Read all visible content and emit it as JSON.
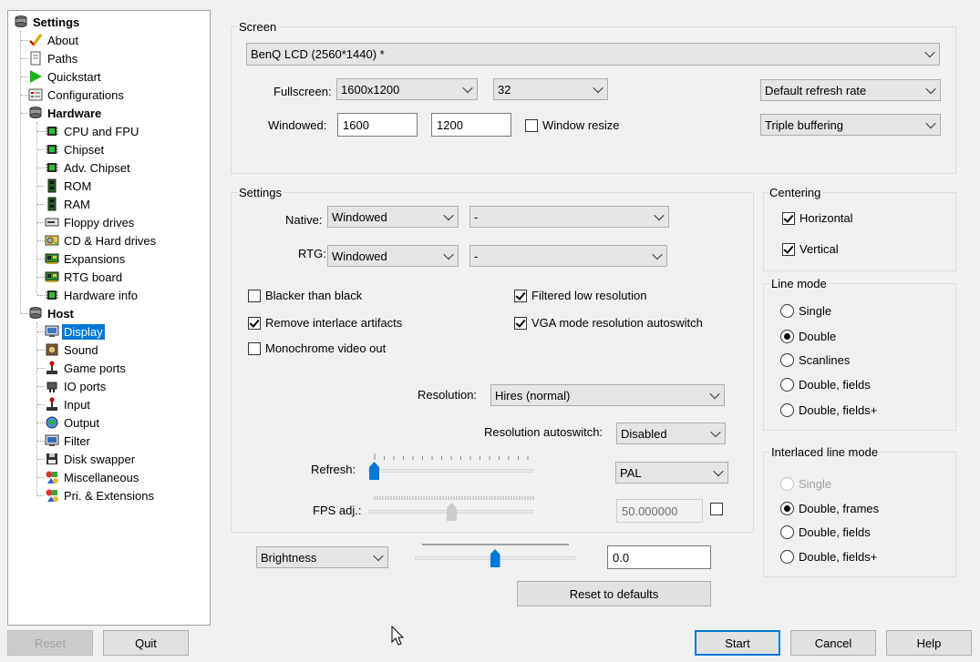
{
  "tree": {
    "items": [
      {
        "label": "Settings",
        "bold": true,
        "icon": "disk-stack-icon"
      },
      {
        "label": "About",
        "icon": "checkmark-pen-icon"
      },
      {
        "label": "Paths",
        "icon": "document-icon"
      },
      {
        "label": "Quickstart",
        "icon": "play-triangle-icon"
      },
      {
        "label": "Configurations",
        "icon": "list-window-icon"
      },
      {
        "label": "Hardware",
        "bold": true,
        "icon": "disk-stack-icon"
      },
      {
        "label": "CPU and FPU",
        "icon": "chip-icon"
      },
      {
        "label": "Chipset",
        "icon": "chip-icon"
      },
      {
        "label": "Adv. Chipset",
        "icon": "chip-icon"
      },
      {
        "label": "ROM",
        "icon": "memory-icon"
      },
      {
        "label": "RAM",
        "icon": "memory-icon"
      },
      {
        "label": "Floppy drives",
        "icon": "floppy-drive-icon"
      },
      {
        "label": "CD & Hard drives",
        "icon": "hard-drive-icon"
      },
      {
        "label": "Expansions",
        "icon": "expansion-card-icon"
      },
      {
        "label": "RTG board",
        "icon": "expansion-card-icon"
      },
      {
        "label": "Hardware info",
        "icon": "chip-icon"
      },
      {
        "label": "Host",
        "bold": true,
        "icon": "disk-stack-icon"
      },
      {
        "label": "Display",
        "selected": true,
        "icon": "monitor-icon"
      },
      {
        "label": "Sound",
        "icon": "speaker-icon"
      },
      {
        "label": "Game ports",
        "icon": "joystick-icon"
      },
      {
        "label": "IO ports",
        "icon": "plug-icon"
      },
      {
        "label": "Input",
        "icon": "joystick-icon"
      },
      {
        "label": "Output",
        "icon": "globe-icon"
      },
      {
        "label": "Filter",
        "icon": "monitor-filter-icon"
      },
      {
        "label": "Disk swapper",
        "icon": "disk-icon"
      },
      {
        "label": "Miscellaneous",
        "icon": "misc-shapes-icon"
      },
      {
        "label": "Pri. & Extensions",
        "icon": "misc-shapes-icon"
      }
    ]
  },
  "screen": {
    "title": "Screen",
    "monitor": "BenQ LCD (2560*1440) *",
    "fullscreen_label": "Fullscreen:",
    "fullscreen_res": "1600x1200",
    "fullscreen_depth": "32",
    "refresh_rate": "Default refresh rate",
    "windowed_label": "Windowed:",
    "windowed_w": "1600",
    "windowed_h": "1200",
    "window_resize": "Window resize",
    "buffering": "Triple buffering"
  },
  "settings": {
    "title": "Settings",
    "native_label": "Native:",
    "native_mode": "Windowed",
    "native_extra": "-",
    "rtg_label": "RTG:",
    "rtg_mode": "Windowed",
    "rtg_extra": "-",
    "blacker": "Blacker than black",
    "remove_interlace": "Remove interlace artifacts",
    "monochrome": "Monochrome video out",
    "filtered_lowres": "Filtered low resolution",
    "vga_autoswitch": "VGA mode resolution autoswitch",
    "resolution_label": "Resolution:",
    "resolution": "Hires (normal)",
    "res_autoswitch_label": "Resolution autoswitch:",
    "res_autoswitch": "Disabled",
    "refresh_label": "Refresh:",
    "refresh_mode": "PAL",
    "fps_label": "FPS adj.:",
    "fps_value": "50.000000",
    "checks": {
      "blacker": false,
      "remove_interlace": true,
      "monochrome": false,
      "filtered_lowres": true,
      "vga_autoswitch": true,
      "fps_enable": false,
      "window_resize": false
    },
    "refresh_level": 0.0,
    "fps_level": 0.5
  },
  "centering": {
    "title": "Centering",
    "horizontal": "Horizontal",
    "vertical": "Vertical",
    "h_on": true,
    "v_on": true
  },
  "line_mode": {
    "title": "Line mode",
    "options": [
      "Single",
      "Double",
      "Scanlines",
      "Double, fields",
      "Double, fields+"
    ],
    "selected": 1
  },
  "interlaced": {
    "title": "Interlaced line mode",
    "options": [
      "Single",
      "Double, frames",
      "Double, fields",
      "Double, fields+"
    ],
    "selected": 1
  },
  "brightness": {
    "mode": "Brightness",
    "value": "0.0",
    "level": 0.5
  },
  "buttons": {
    "reset_defaults": "Reset to defaults",
    "reset": "Reset",
    "quit": "Quit",
    "start": "Start",
    "cancel": "Cancel",
    "help": "Help"
  },
  "colors": {
    "accent": "#0078d7",
    "selection": "#0078d7"
  }
}
